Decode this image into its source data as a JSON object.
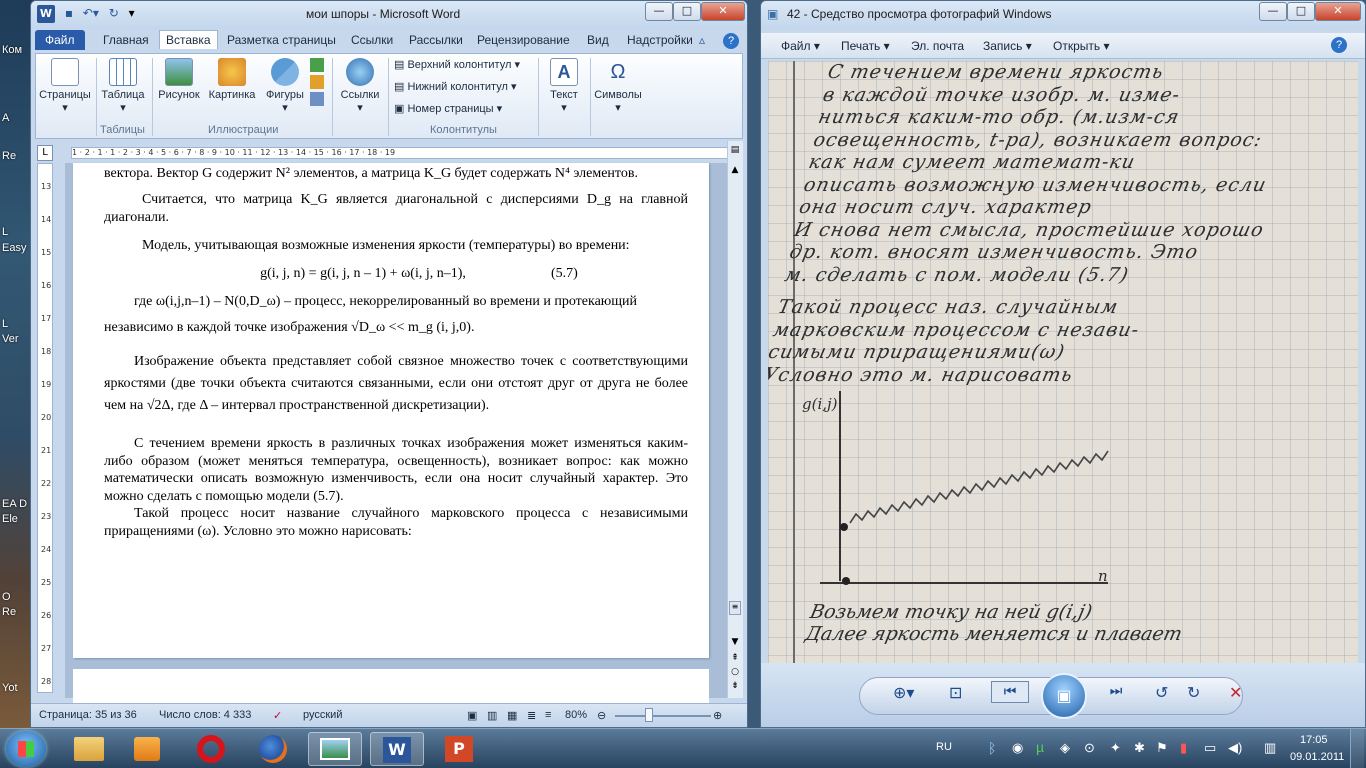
{
  "desktop": {
    "labels": [
      "Ком",
      "A",
      "Re",
      "L",
      "Easy",
      "L",
      "Ver",
      "EA D",
      "Ele",
      "O",
      "Re",
      "Yot"
    ]
  },
  "word": {
    "title": "мои шпоры - Microsoft Word",
    "logo": "W",
    "tabs": [
      "Файл",
      "Главная",
      "Вставка",
      "Разметка страницы",
      "Ссылки",
      "Рассылки",
      "Рецензирование",
      "Вид",
      "Надстройки"
    ],
    "ribbon": {
      "pages": "Страницы",
      "table": "Таблица",
      "picture": "Рисунок",
      "clipart": "Картинка",
      "shapes": "Фигуры",
      "links": "Ссылки",
      "header": "Верхний колонтитул",
      "footer": "Нижний колонтитул",
      "page_number": "Номер страницы",
      "text": "Текст",
      "symbols": "Символы",
      "group_tables": "Таблицы",
      "group_illustrations": "Иллюстрации",
      "group_headers": "Колонтитулы"
    },
    "ruler_marks": "1 · 2 · 1 · 1 · 2 · 3 · 4 · 5 · 6 · 7 · 8 · 9 · 10 · 11 · 12 · 13 · 14 · 15 · 16 · 17 · 18 · 19",
    "vruler_marks": [
      "13",
      "14",
      "15",
      "16",
      "17",
      "18",
      "19",
      "20",
      "21",
      "22",
      "23",
      "24",
      "25",
      "26",
      "27",
      "28"
    ],
    "doc": {
      "p1": "вектора. Вектор G содержит N² элементов, а матрица K_G будет содержать N⁴ элементов.",
      "p2": "Считается, что матрица K_G является диагональной с дисперсиями D_g на главной диагонали.",
      "p3": "Модель, учитывающая возможные изменения яркости (температуры) во времени:",
      "eq": "g(i, j, n) = g(i, j, n – 1) + ω(i, j, n–1),",
      "eq_num": "(5.7)",
      "p4a": "где ω(i,j,n–1) – N(0,D_ω) – процесс, некоррелированный во времени и протекающий",
      "p4b": "независимо в каждой точке изображения √D_ω << m_g (i, j,0).",
      "p5": "Изображение объекта представляет собой связное множество точек с соответствующими яркостями (две точки объекта считаются связанными, если они отстоят друг от друга не более чем на √2Δ, где Δ – интервал пространственной дискретизации).",
      "p6": "С течением времени яркость в различных точках изображения может изменяться каким-либо образом (может меняться температура, освещенность), возникает вопрос: как можно математически описать возможную изменчивость, если она носит случайный характер. Это можно сделать с помощью модели (5.7).",
      "p7": "Такой процесс носит название случайного марковского процесса с независимыми приращениями (ω). Условно это можно нарисовать:"
    },
    "status": {
      "page": "Страница: 35 из 36",
      "words": "Число слов: 4 333",
      "lang": "русский",
      "zoom": "80%"
    }
  },
  "viewer": {
    "title": "42 - Средство просмотра фотографий Windows",
    "menu": [
      "Файл",
      "Печать",
      "Эл. почта",
      "Запись",
      "Открыть"
    ],
    "photo_lines": [
      "С течением времени яркость",
      "в каждой точке изобр. м. изме-",
      "ниться каким-то обр. (м.изм-ся",
      "освещенность, t-ра), возникает вопрос:",
      "как нам сумеет математ-ки",
      "описать возможную изменчивость, если",
      "она носит случ. характер",
      "И снова нет смысла, простейшие хорошо",
      "др. кот. вносят изменчивость. Это",
      "м. сделать с пом. модели (5.7)",
      "Такой процесс наз. случайным",
      "марковским процессом с незави-",
      "симыми приращениями(ω)",
      "Условно это м. нарисовать",
      "Возьмем точку на ней g(i,j)",
      "Далее яркость меняется и плавает"
    ],
    "graph_ylabel": "g(i,j)",
    "graph_xlabel": "n"
  },
  "taskbar": {
    "lang": "RU",
    "time": "17:05",
    "date": "09.01.2011"
  }
}
